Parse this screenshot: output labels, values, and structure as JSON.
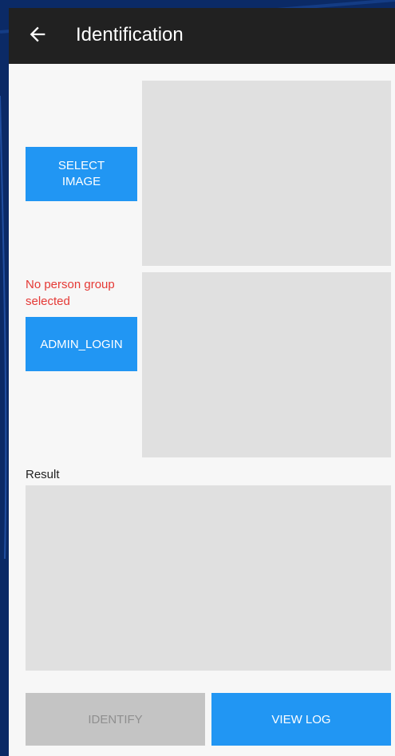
{
  "appbar": {
    "title": "Identification",
    "back_icon": "arrow-back-icon"
  },
  "buttons": {
    "select_image": "SELECT\nIMAGE",
    "admin_login": "ADMIN_LOGIN",
    "identify": "IDENTIFY",
    "view_log": "VIEW LOG"
  },
  "status": {
    "no_group": "No person group selected"
  },
  "result": {
    "label": "Result"
  },
  "colors": {
    "appbar": "#212121",
    "accent": "#2196f3",
    "error": "#e53935",
    "disabled": "#c4c4c4",
    "placeholder": "#e0e0e0"
  }
}
